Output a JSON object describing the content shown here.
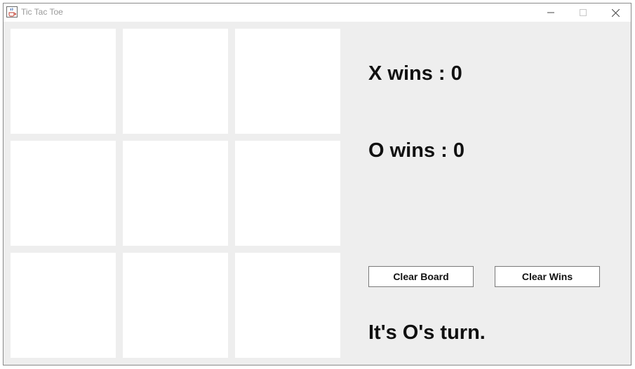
{
  "window": {
    "title": "Tic Tac Toe",
    "icons": {
      "app": "java-cup-icon",
      "minimize": "minimize-icon",
      "maximize": "maximize-icon",
      "close": "close-icon"
    }
  },
  "board": {
    "cells": [
      "",
      "",
      "",
      "",
      "",
      "",
      "",
      "",
      ""
    ]
  },
  "scores": {
    "x_label": "X wins : 0",
    "o_label": "O wins : 0"
  },
  "buttons": {
    "clear_board": "Clear Board",
    "clear_wins": "Clear Wins"
  },
  "status": "It's O's turn.",
  "colors": {
    "panel_bg": "#eeeeee",
    "cell_bg": "#ffffff",
    "text": "#111111"
  }
}
